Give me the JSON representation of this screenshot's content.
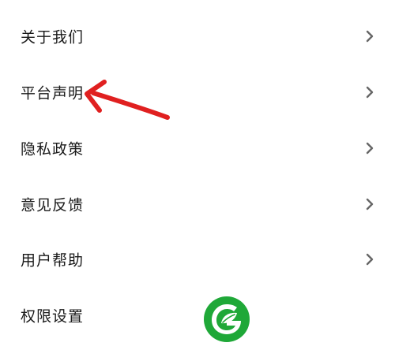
{
  "menu": {
    "items": [
      {
        "label": "关于我们",
        "icon": "chevron-right-icon"
      },
      {
        "label": "平台声明",
        "icon": "chevron-right-icon"
      },
      {
        "label": "隐私政策",
        "icon": "chevron-right-icon"
      },
      {
        "label": "意见反馈",
        "icon": "chevron-right-icon"
      },
      {
        "label": "用户帮助",
        "icon": "chevron-right-icon"
      },
      {
        "label": "权限设置",
        "icon": "chevron-right-icon"
      }
    ]
  },
  "annotation": {
    "arrow_color": "#e02020",
    "points_to": "平台声明"
  },
  "logo": {
    "color": "#1fa838",
    "icon": "leaf-logo-icon"
  },
  "colors": {
    "text": "#1a1a1a",
    "chevron": "#666666",
    "background": "#ffffff"
  }
}
